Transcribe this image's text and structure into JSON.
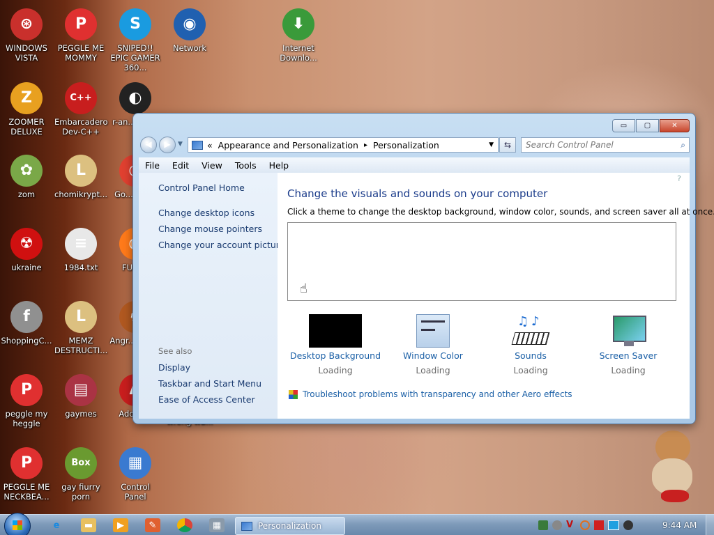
{
  "desktop": {
    "icons": [
      {
        "label": "WINDOWS VISTA",
        "color": "#c9302c",
        "glyph": "⊛"
      },
      {
        "label": "PEGGLE ME MOMMY",
        "color": "#e03030",
        "glyph": "P"
      },
      {
        "label": "SNIPED!! EPIC GAMER 360...",
        "color": "#1a9be0",
        "glyph": "S"
      },
      {
        "label": "Network",
        "color": "#2060b0",
        "glyph": "◉"
      },
      {
        "label": "Internet Downlo...",
        "color": "#3a9a3a",
        "glyph": "⬇"
      },
      {
        "label": "ZOOMER DELUXE",
        "color": "#e8a020",
        "glyph": "Z"
      },
      {
        "label": "Embarcadero Dev-C++",
        "color": "#c81e1e",
        "glyph": "C++"
      },
      {
        "label": "r-an... par...",
        "color": "#222222",
        "glyph": "◐"
      },
      {
        "label": "zom",
        "color": "#7aa848",
        "glyph": "✿"
      },
      {
        "label": "chomikrypt...",
        "color": "#dcc080",
        "glyph": "L"
      },
      {
        "label": "Go... Chi...",
        "color": "#e04030",
        "glyph": "◎"
      },
      {
        "label": "ukraine",
        "color": "#d01010",
        "glyph": "☢"
      },
      {
        "label": "1984.txt",
        "color": "#e8e8e8",
        "glyph": "≡"
      },
      {
        "label": "FURY...",
        "color": "#ff7a1a",
        "glyph": "◍"
      },
      {
        "label": "ShoppingC...",
        "color": "#909090",
        "glyph": "f"
      },
      {
        "label": "MEMZ DESTRUCTI...",
        "color": "#dcc080",
        "glyph": "L"
      },
      {
        "label": "Angr... Sea...",
        "color": "#b05820",
        "glyph": "♞"
      },
      {
        "label": "peggle my heggle",
        "color": "#e03030",
        "glyph": "P"
      },
      {
        "label": "gaymes",
        "color": "#aa3344",
        "glyph": "▤"
      },
      {
        "label": "Adobe...",
        "color": "#c81e1e",
        "glyph": "A"
      },
      {
        "label": "PEGGLE ME NECKBEA...",
        "color": "#e03030",
        "glyph": "P"
      },
      {
        "label": "gay fiurry porn",
        "color": "#6a9a30",
        "glyph": "Box"
      },
      {
        "label": "Control Panel",
        "color": "#3a7ad0",
        "glyph": "▦"
      }
    ],
    "hidden_label": "wrong wa..."
  },
  "window": {
    "breadcrumb": {
      "prefix": "«",
      "parent": "Appearance and Personalization",
      "sep": "▸",
      "current": "Personalization"
    },
    "search_placeholder": "Search Control Panel",
    "controls": {
      "minimize": "▭",
      "maximize": "▢",
      "close": "✕"
    },
    "menu": [
      "File",
      "Edit",
      "View",
      "Tools",
      "Help"
    ],
    "left_links": {
      "home": "Control Panel Home",
      "desktop_icons": "Change desktop icons",
      "mouse_pointers": "Change mouse pointers",
      "account_picture": "Change your account picture",
      "see_also": "See also",
      "display": "Display",
      "taskbar": "Taskbar and Start Menu",
      "ease_access": "Ease of Access Center"
    },
    "heading": "Change the visuals and sounds on your computer",
    "description": "Click a theme to change the desktop background, window color, sounds, and screen saver all at once.",
    "tiles": [
      {
        "label": "Desktop Background",
        "status": "Loading",
        "icon": "black-square"
      },
      {
        "label": "Window Color",
        "status": "Loading",
        "icon": "window-color-icon"
      },
      {
        "label": "Sounds",
        "status": "Loading",
        "icon": "piano-notes-icon"
      },
      {
        "label": "Screen Saver",
        "status": "Loading",
        "icon": "monitor-bubbles-icon"
      }
    ],
    "troubleshoot": "Troubleshoot problems with transparency and other Aero effects",
    "help_icon": "?"
  },
  "taskbar": {
    "active_window": "Personalization",
    "time": "9:44 AM"
  }
}
